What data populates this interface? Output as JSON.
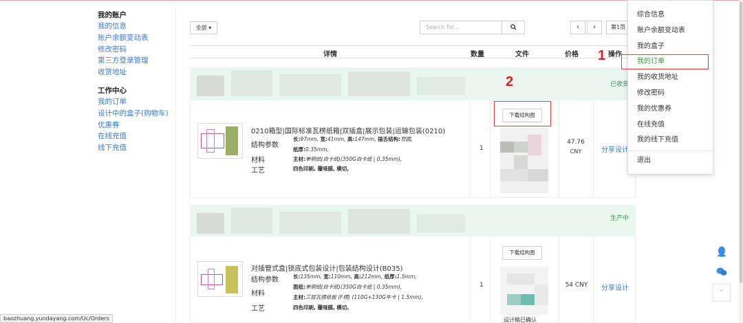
{
  "sidebar": {
    "account_title": "我的账户",
    "account_items": [
      "我的信息",
      "账户余额变动表",
      "修改密码",
      "第三方登录管理",
      "收货地址"
    ],
    "work_title": "工作中心",
    "work_items": [
      "我的订单",
      "设计中的盒子(购物车)",
      "优惠券",
      "在线充值",
      "线下充值"
    ]
  },
  "toolbar": {
    "all_label": "全部 ▾",
    "search_placeholder": "Search for...",
    "search_icon": "search-icon",
    "prev": "‹",
    "next": "›",
    "page_label": "第1页"
  },
  "table_header": {
    "details": "详情",
    "qty": "数量",
    "file": "文件",
    "price": "价格",
    "ops": "操作"
  },
  "orders": [
    {
      "status": "已收货",
      "title": "0210箱型|国际标准瓦楞纸箱|双插盒|展示包装|运输包装(0210)",
      "params_label": "结构参数",
      "params_line1_k1": "长:",
      "params_line1_v1": "97mm,",
      "params_line1_k2": "宽:",
      "params_line1_v2": "41mm,",
      "params_line1_k3": "高:",
      "params_line1_v3": "147mm,",
      "params_line1_k4": "插舌结构:",
      "params_line1_v4": "导圆,",
      "params_line2_k": "纸厚:",
      "params_line2_v": "0.35mm,",
      "material_label": "材料",
      "material_k": "主材:",
      "material_v": "单铜纸(白卡纸)(350G白卡纸 | 0.35mm),",
      "craft_label": "工艺",
      "craft_v": "四色印刷, 覆哑膜, 模切,",
      "qty": "1",
      "download_label": "下载结构图",
      "price": "47.76",
      "currency": "CNY",
      "share_label": "分享设计"
    },
    {
      "status": "生产中",
      "title": "对插管式盒|锁底式包装设计|包装结构设计(B035)",
      "params_label": "结构参数",
      "params_line1_k1": "长:",
      "params_line1_v1": "135mm,",
      "params_line1_k2": "宽:",
      "params_line1_v2": "110mm,",
      "params_line1_k3": "高:",
      "params_line1_v3": "212mm,",
      "params_line1_k4": "纸厚:",
      "params_line1_v4": "1.5mm,",
      "params_line2_k": "面纸:",
      "params_line2_v": "单铜纸(白卡纸)(350G白卡纸 | 0.35mm),",
      "material_label": "材料",
      "material_k": "主材:",
      "material_v": "三层瓦楞纸板 (F楞) (110G+130G牛卡 | 1.5mm),",
      "craft_label": "工艺",
      "craft_v": "四色印刷, 覆哑膜, 模切,",
      "qty": "1",
      "download_label": "下载结构图",
      "price_full": "54 CNY",
      "share_label": "分享设计",
      "partial_text": "设计稿已确认"
    }
  ],
  "annotations": {
    "n1": "1",
    "n2": "2"
  },
  "dropdown": {
    "items": [
      "综合信息",
      "账户余额变动表",
      "我的盒子",
      "我的订单",
      "我的收货地址",
      "修改密码",
      "我的优惠券",
      "在线充值",
      "我的线下充值"
    ],
    "logout": "退出",
    "active_index": 3
  },
  "floating": {
    "qq_icon": "qq-icon",
    "wechat_icon": "wechat-icon",
    "top_icon": "back-to-top-icon"
  },
  "statusbar": {
    "url": "baozhuang.yundayang.com/Uc/Orders"
  },
  "colors": {
    "link": "#3a7bd5",
    "status_green": "#3a8d5d",
    "annotation_red": "#e02020",
    "header_bg": "#e9f7ef"
  }
}
